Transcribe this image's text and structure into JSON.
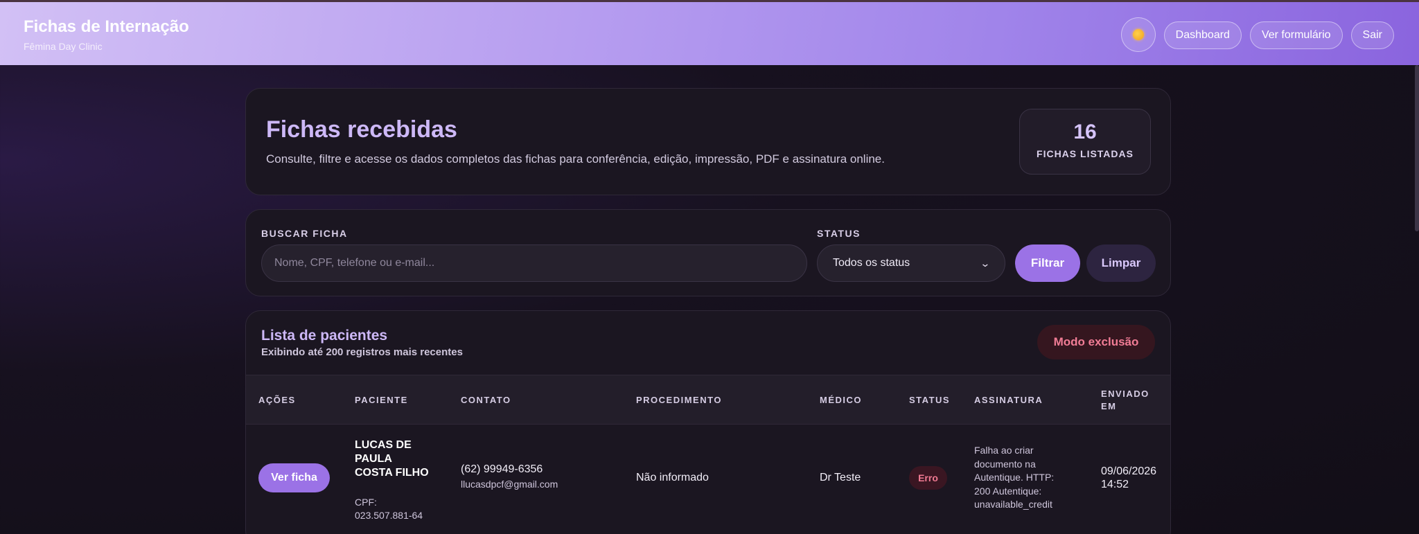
{
  "header": {
    "title": "Fichas de Internação",
    "subtitle": "Fêmina Day Clinic",
    "theme_icon": "sun-icon",
    "nav": {
      "dashboard": "Dashboard",
      "form": "Ver formulário",
      "logout": "Sair"
    },
    "gradient_colors": [
      "#d2c0f5",
      "#8a64de"
    ]
  },
  "hero": {
    "title": "Fichas recebidas",
    "description": "Consulte, filtre e acesse os dados completos das fichas para conferência, edição, impressão, PDF e assinatura online.",
    "count": "16",
    "count_label": "FICHAS LISTADAS"
  },
  "filters": {
    "search_label": "BUSCAR FICHA",
    "search_placeholder": "Nome, CPF, telefone ou e-mail...",
    "search_value": "",
    "status_label": "STATUS",
    "status_selected": "Todos os status",
    "filter_button": "Filtrar",
    "clear_button": "Limpar"
  },
  "list": {
    "title": "Lista de pacientes",
    "subtitle": "Exibindo até 200 registros mais recentes",
    "delete_mode_button": "Modo exclusão",
    "columns": {
      "actions": "AÇÕES",
      "patient": "PACIENTE",
      "contact": "CONTATO",
      "procedure": "PROCEDIMENTO",
      "doctor": "MÉDICO",
      "status": "STATUS",
      "signature": "ASSINATURA",
      "sent_at": "ENVIADO EM"
    },
    "rows": [
      {
        "action": "Ver ficha",
        "name": "LUCAS DE PAULA COSTA FILHO",
        "cpf": "CPF: 023.507.881-64",
        "phone": "(62) 99949-6356",
        "email": "llucasdpcf@gmail.com",
        "procedure": "Não informado",
        "doctor": "Dr Teste",
        "status": "Erro",
        "signature": "Falha ao criar documento na Autentique. HTTP: 200 Autentique: unavailable_credit",
        "sent_at": "09/06/2026 14:52"
      }
    ]
  },
  "colors": {
    "accent": "#9b72e6",
    "error": "#f07a92",
    "card_bg": "#1b1621"
  }
}
